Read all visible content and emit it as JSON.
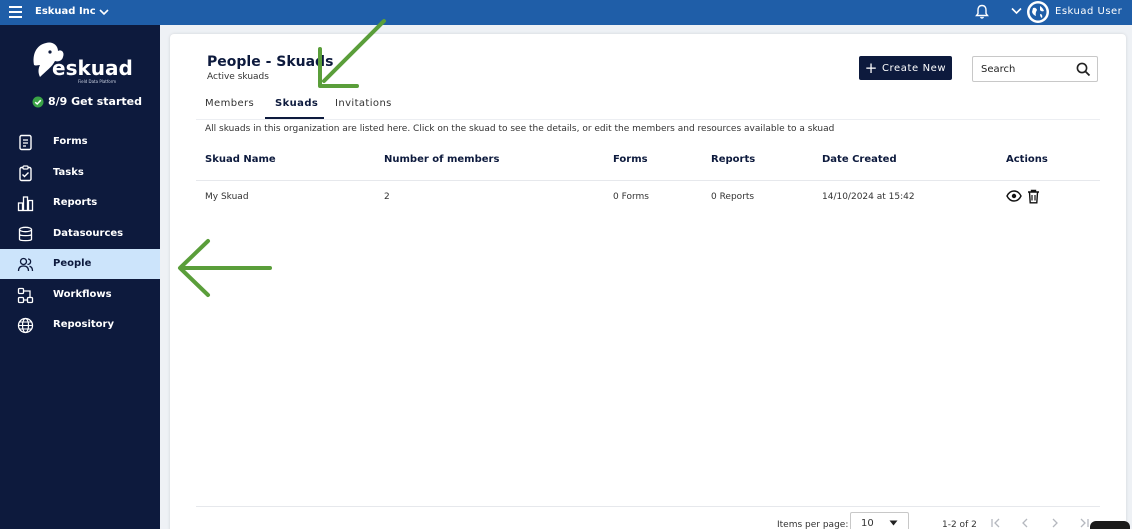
{
  "topbar": {
    "org_name": "Eskuad Inc",
    "user_name": "Eskuad User"
  },
  "sidebar": {
    "logo_text": "eskuad",
    "logo_tagline": "Field Data Platform",
    "get_started": "8/9 Get started",
    "items": [
      {
        "label": "Forms",
        "icon": "forms-icon"
      },
      {
        "label": "Tasks",
        "icon": "tasks-icon"
      },
      {
        "label": "Reports",
        "icon": "reports-icon"
      },
      {
        "label": "Datasources",
        "icon": "database-icon"
      },
      {
        "label": "People",
        "icon": "people-icon",
        "active": true
      },
      {
        "label": "Workflows",
        "icon": "workflow-icon"
      },
      {
        "label": "Repository",
        "icon": "globe-icon"
      }
    ]
  },
  "page": {
    "title": "People - Skuads",
    "subtitle": "Active skuads",
    "create_button": "Create New",
    "search_placeholder": "Search",
    "tabs": [
      {
        "label": "Members"
      },
      {
        "label": "Skuads",
        "active": true
      },
      {
        "label": "Invitations"
      }
    ],
    "description": "All skuads in this organization are listed here. Click on the skuad to see the details, or edit the members and resources available to a skuad"
  },
  "table": {
    "columns": [
      "Skuad Name",
      "Number of members",
      "Forms",
      "Reports",
      "Date Created",
      "Actions"
    ],
    "rows": [
      {
        "name": "My Skuad",
        "members": "2",
        "forms": "0 Forms",
        "reports": "0 Reports",
        "date": "14/10/2024 at 15:42"
      }
    ]
  },
  "pagination": {
    "items_per_page_label": "Items per page:",
    "items_per_page": "10",
    "range": "1-2 of 2"
  },
  "colors": {
    "topbar": "#1f5ea8",
    "sidebar": "#0d1a3d",
    "active_nav": "#cce4fb",
    "primary_button": "#0d1a3d",
    "annotation_arrow": "#5a9e3a"
  }
}
